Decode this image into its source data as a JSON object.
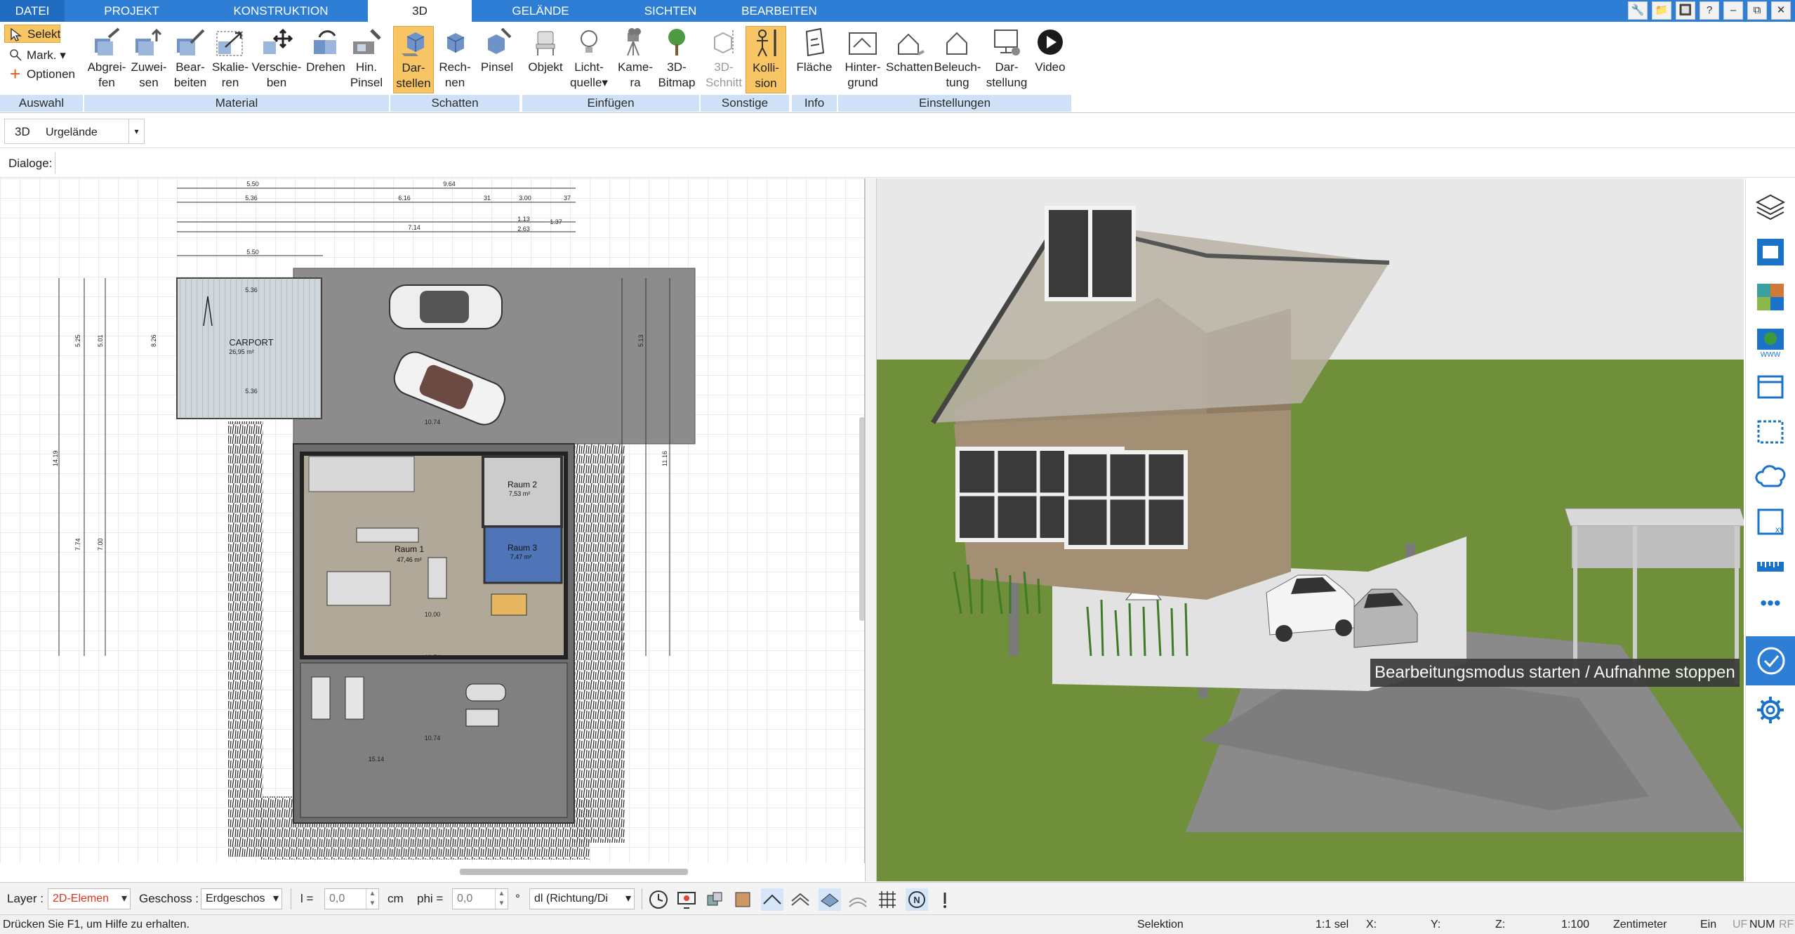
{
  "tabs": [
    "DATEI",
    "PROJEKT",
    "KONSTRUKTION",
    "3D",
    "GELÄNDE",
    "SICHTEN",
    "BEARBEITEN"
  ],
  "active_tab": "3D",
  "window_controls": [
    "🔧",
    "📁",
    "🔲",
    "?",
    "–",
    "⧉",
    "✕"
  ],
  "ribbon": {
    "auswahl": {
      "selekt": "Selekt",
      "mark": "Mark.",
      "optionen": "Optionen",
      "group": "Auswahl"
    },
    "material": {
      "group": "Material",
      "buttons": [
        [
          "Abgrei-",
          "fen"
        ],
        [
          "Zuwei-",
          "sen"
        ],
        [
          "Bear-",
          "beiten"
        ],
        [
          "Skalie-",
          "ren"
        ],
        [
          "Verschie-",
          "ben"
        ],
        [
          "Drehen",
          ""
        ],
        [
          "Hin.",
          "Pinsel"
        ]
      ]
    },
    "schatten": {
      "group": "Schatten",
      "buttons": [
        [
          "Dar-",
          "stellen"
        ],
        [
          "Rech-",
          "nen"
        ],
        [
          "Pinsel",
          ""
        ]
      ]
    },
    "einfuegen": {
      "group": "Einfügen",
      "buttons": [
        [
          "Objekt",
          ""
        ],
        [
          "Licht-",
          "quelle"
        ],
        [
          "Kame-",
          "ra"
        ],
        [
          "3D-",
          "Bitmap"
        ]
      ]
    },
    "sonstige": {
      "group": "Sonstige",
      "buttons": [
        [
          "3D-",
          "Schnitt"
        ],
        [
          "Kolli-",
          "sion"
        ]
      ]
    },
    "info": {
      "group": "Info",
      "buttons": [
        [
          "Fläche",
          ""
        ]
      ]
    },
    "einstellungen": {
      "group": "Einstellungen",
      "buttons": [
        [
          "Hinter-",
          "grund"
        ],
        [
          "Schatten",
          ""
        ],
        [
          "Beleuch-",
          "tung"
        ],
        [
          "Dar-",
          "stellung"
        ],
        [
          "Video",
          ""
        ]
      ]
    }
  },
  "row2": {
    "mode": "3D",
    "terrain": "Urgelände"
  },
  "row3": {
    "dialoge": "Dialoge:"
  },
  "plan": {
    "labels": {
      "carport": "CARPORT",
      "carport_area": "26,95 m²",
      "raum1": "Raum 1",
      "raum1_area": "47,46 m²",
      "raum2": "Raum 2",
      "raum2_area": "7,53 m²",
      "raum3": "Raum 3",
      "raum3_area": "7,47 m²"
    },
    "dims": {
      "d550a": "5.50",
      "d550b": "5.50",
      "d964": "9.64",
      "d616": "6.16",
      "d714": "7.14",
      "d536a": "5.36",
      "d536b": "5.36",
      "d536c": "5.36",
      "d31": "31",
      "d300": "3.00",
      "d37": "37",
      "d113": "1.13",
      "d137": "1.37",
      "d263": "2.63",
      "d1074a": "10.74",
      "d1074b": "10.74",
      "d1074c": "10.74",
      "d1000": "10.00",
      "d1514": "15.14",
      "d525": "5.25",
      "d501": "5.01",
      "d826": "8.26",
      "d1419": "14.19",
      "d774": "7.74",
      "d700": "7.00",
      "d513": "5.13",
      "d1116": "11.16"
    }
  },
  "tooltip": "Bearbeitungsmodus starten / Aufnahme stoppen",
  "statusbar": {
    "layer_label": "Layer :",
    "layer_value": "2D-Elemen",
    "geschoss_label": "Geschoss :",
    "geschoss_value": "Erdgeschos",
    "l_label": "l =",
    "l_value": "0,0",
    "l_unit": "cm",
    "phi_label": "phi =",
    "phi_value": "0,0",
    "phi_unit": "°",
    "dl_value": "dl (Richtung/Di"
  },
  "infobar": {
    "help": "Drücken Sie F1, um Hilfe zu erhalten.",
    "mode": "Selektion",
    "sel": "1:1 sel",
    "x": "X:",
    "y": "Y:",
    "z": "Z:",
    "scale": "1:100",
    "unit": "Zentimeter",
    "ein": "Ein",
    "uf": "UF",
    "num": "NUM",
    "rf": "RF"
  }
}
